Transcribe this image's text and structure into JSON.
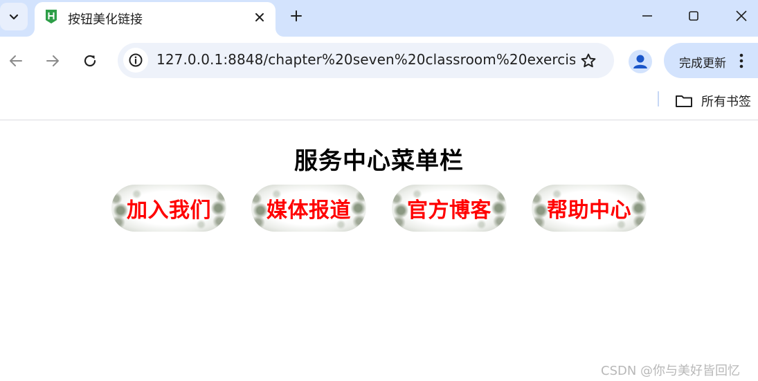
{
  "browser": {
    "tab": {
      "title": "按钮美化链接",
      "favicon": "hbuilder-favicon-icon",
      "favicon_color": "#2e9e48"
    },
    "address_bar": {
      "url": "127.0.0.1:8848/chapter%20seven%20classroom%20exercis..."
    },
    "update_button": {
      "label": "完成更新"
    },
    "bookmarks": {
      "all_bookmarks_label": "所有书签"
    },
    "colors": {
      "tabstrip": "#d3e3fd",
      "omnibox": "#eef2fa",
      "update_button": "#d3e3fd"
    }
  },
  "page": {
    "title": "服务中心菜单栏",
    "menu": [
      {
        "label": "加入我们"
      },
      {
        "label": "媒体报道"
      },
      {
        "label": "官方博客"
      },
      {
        "label": "帮助中心"
      }
    ],
    "link_color": "#ff0000"
  },
  "watermark": "CSDN @你与美好皆回忆"
}
